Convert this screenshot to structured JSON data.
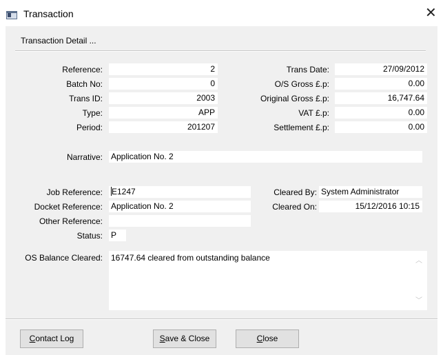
{
  "window": {
    "title": "Transaction",
    "close_symbol": "✕"
  },
  "section": {
    "title": "Transaction Detail ..."
  },
  "fields_left": [
    {
      "label": "Reference:",
      "value": "2"
    },
    {
      "label": "Batch No:",
      "value": "0"
    },
    {
      "label": "Trans ID:",
      "value": "2003"
    },
    {
      "label": "Type:",
      "value": "APP"
    },
    {
      "label": "Period:",
      "value": "201207"
    }
  ],
  "fields_right": [
    {
      "label": "Trans Date:",
      "value": "27/09/2012"
    },
    {
      "label": "O/S Gross £.p:",
      "value": "0.00"
    },
    {
      "label": "Original Gross £.p:",
      "value": "16,747.64"
    },
    {
      "label": "VAT £.p:",
      "value": "0.00"
    },
    {
      "label": "Settlement £.p:",
      "value": "0.00"
    }
  ],
  "narrative": {
    "label": "Narrative:",
    "value": "Application No. 2"
  },
  "job_reference": {
    "label": "Job Reference:",
    "value": "E1247"
  },
  "docket_reference": {
    "label": "Docket Reference:",
    "value": "Application No. 2"
  },
  "other_reference": {
    "label": "Other Reference:",
    "value": ""
  },
  "status": {
    "label": "Status:",
    "value": "P"
  },
  "cleared_by": {
    "label": "Cleared By:",
    "value": "System Administrator"
  },
  "cleared_on": {
    "label": "Cleared On:",
    "value": "15/12/2016 10:15"
  },
  "os_balance": {
    "label": "OS Balance Cleared:",
    "value": "16747.64 cleared from outstanding balance"
  },
  "buttons": {
    "contact_log": {
      "pre": "",
      "key": "C",
      "post": "ontact Log"
    },
    "save_close": {
      "pre": "",
      "key": "S",
      "post": "ave & Close"
    },
    "close": {
      "pre": "",
      "key": "C",
      "post": "lose"
    }
  }
}
